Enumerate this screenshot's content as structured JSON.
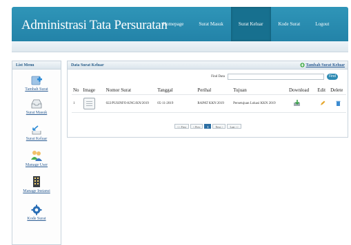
{
  "app": {
    "title": "Administrasi Tata Persuratan"
  },
  "nav": {
    "items": [
      {
        "label": "Homepage",
        "active": false
      },
      {
        "label": "Surat Masuk",
        "active": false
      },
      {
        "label": "Surat Keluar",
        "active": true
      },
      {
        "label": "Kode Surat",
        "active": false
      },
      {
        "label": "Logout",
        "active": false
      }
    ]
  },
  "left_menu": {
    "title": "List Menu",
    "items": [
      {
        "label": "Tambah Surat",
        "icon": "add-document-icon"
      },
      {
        "label": "Surat Masuk",
        "icon": "inbox-icon"
      },
      {
        "label": "Surat Keluar",
        "icon": "outbox-icon"
      },
      {
        "label": "Manage User",
        "icon": "users-icon"
      },
      {
        "label": "Manage Instansi",
        "icon": "building-icon"
      },
      {
        "label": "Kode Surat",
        "icon": "gear-icon"
      }
    ]
  },
  "content": {
    "title": "Data Surat Keluar",
    "add_link": "Tambah Surat Keluar",
    "find": {
      "label": "Find Data",
      "button": "Find",
      "value": ""
    },
    "table": {
      "columns": [
        "No",
        "Image",
        "Nomor Surat",
        "Tanggal",
        "Perihal",
        "Tujuan",
        "Download",
        "Edit",
        "Delete"
      ],
      "rows": [
        {
          "no": "1",
          "nomor": "022/PUSINFO-KNG/KN/2019",
          "tanggal": "05-11-2019",
          "perihal": "RAPAT KKN 2019",
          "tujuan": "Persetujuan Lokasi KKN 2019"
        }
      ]
    },
    "pager": [
      "<< First",
      "< Prev",
      "1",
      "Next >",
      "Last >>"
    ],
    "pager_active": "1"
  },
  "colors": {
    "header": "#2383a8",
    "active_nav": "#17708f",
    "link": "#2b5c93"
  }
}
